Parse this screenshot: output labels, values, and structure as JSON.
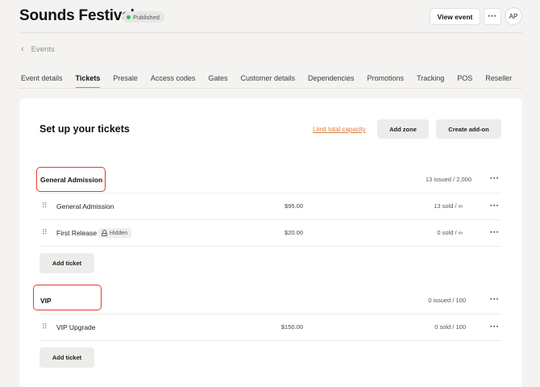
{
  "header": {
    "title": "Sounds Festival",
    "status_badge": "Published",
    "view_event_label": "View event",
    "more_label": "···",
    "avatar_initials": "AP"
  },
  "breadcrumb": {
    "back_label": "Events"
  },
  "tabs": [
    {
      "label": "Event details",
      "active": false
    },
    {
      "label": "Tickets",
      "active": true
    },
    {
      "label": "Presale",
      "active": false
    },
    {
      "label": "Access codes",
      "active": false
    },
    {
      "label": "Gates",
      "active": false
    },
    {
      "label": "Customer details",
      "active": false
    },
    {
      "label": "Dependencies",
      "active": false
    },
    {
      "label": "Promotions",
      "active": false
    },
    {
      "label": "Tracking",
      "active": false
    },
    {
      "label": "POS",
      "active": false
    },
    {
      "label": "Reseller",
      "active": false
    }
  ],
  "main": {
    "heading": "Set up your tickets",
    "limit_capacity_link": "Limit total capacity",
    "add_zone_label": "Add zone",
    "create_addon_label": "Create add-on",
    "more_label": "···",
    "add_ticket_label": "Add ticket",
    "zones": [
      {
        "name": "General Admission",
        "issued": "13 issued / 2,000",
        "tickets": [
          {
            "name": "General Admission",
            "price": "$95.00",
            "sold": "13 sold / ∞",
            "hidden_tag": ""
          },
          {
            "name": "First Release",
            "price": "$20.00",
            "sold": "0 sold / ∞",
            "hidden_tag": "Hidden"
          }
        ]
      },
      {
        "name": "VIP",
        "issued": "0 issued / 100",
        "tickets": [
          {
            "name": "VIP Upgrade",
            "price": "$150.00",
            "sold": "0 sold / 100",
            "hidden_tag": ""
          }
        ]
      }
    ]
  },
  "colors": {
    "accent": "#ea7a3a",
    "highlight": "#e23b2b",
    "status_green": "#35b85a"
  }
}
